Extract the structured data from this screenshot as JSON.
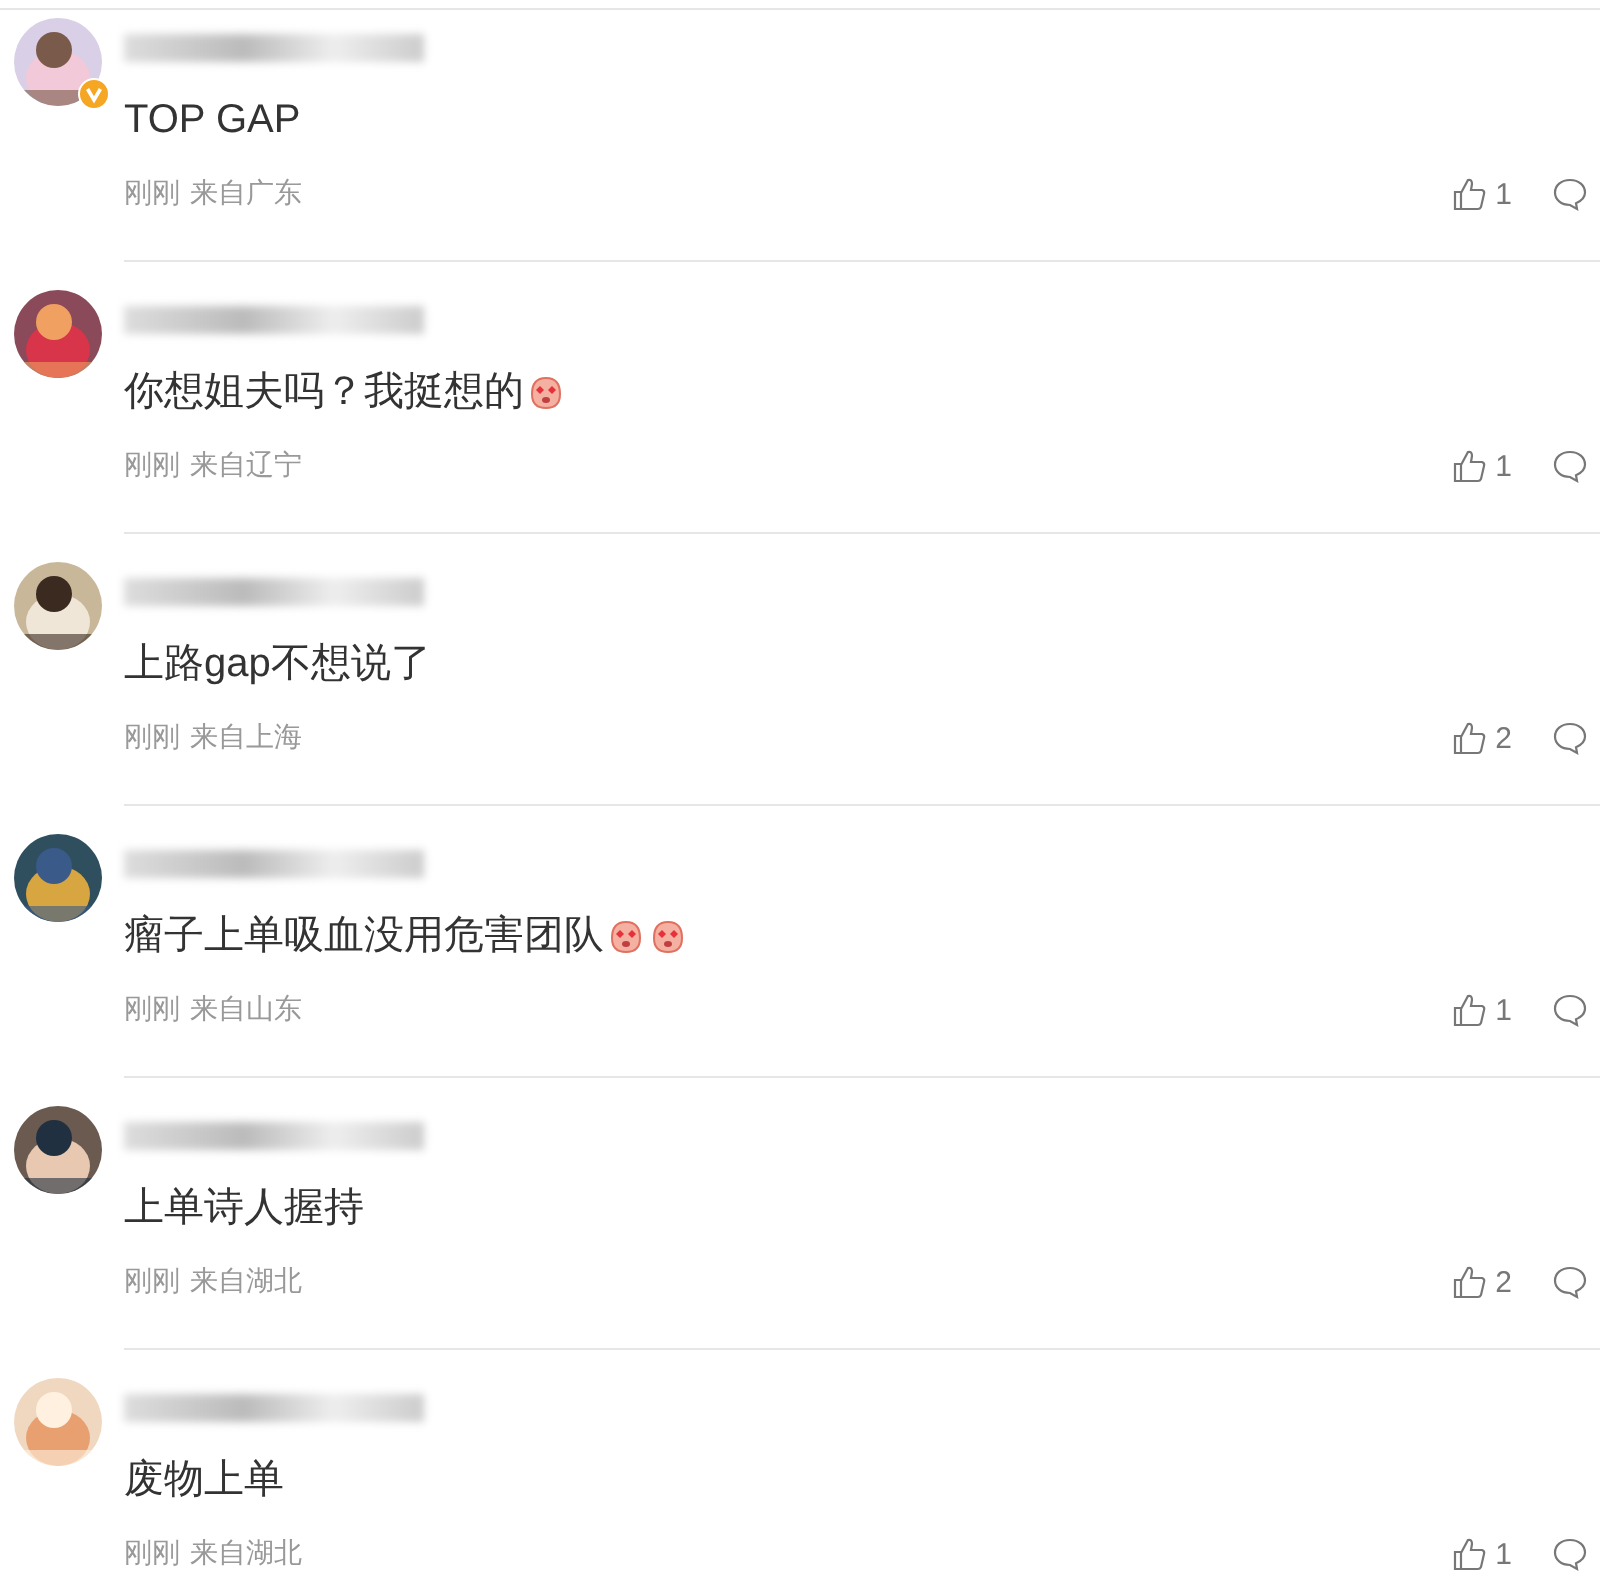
{
  "comments": [
    {
      "verified": true,
      "text": "TOP GAP",
      "time": "刚刚",
      "location": "来自广东",
      "likes": "1"
    },
    {
      "verified": false,
      "text": "你想姐夫吗？我挺想的",
      "emojis": [
        {
          "kind": "face"
        }
      ],
      "time": "刚刚",
      "location": "来自辽宁",
      "likes": "1"
    },
    {
      "verified": false,
      "text": "上路gap不想说了",
      "time": "刚刚",
      "location": "来自上海",
      "likes": "2"
    },
    {
      "verified": false,
      "text": "瘤子上单吸血没用危害团队",
      "emojis": [
        {
          "kind": "face"
        },
        {
          "kind": "face"
        }
      ],
      "time": "刚刚",
      "location": "来自山东",
      "likes": "1"
    },
    {
      "verified": false,
      "text": "上单诗人握持",
      "time": "刚刚",
      "location": "来自湖北",
      "likes": "2"
    },
    {
      "verified": false,
      "text": "废物上单",
      "time": "刚刚",
      "location": "来自湖北",
      "likes": "1"
    }
  ]
}
